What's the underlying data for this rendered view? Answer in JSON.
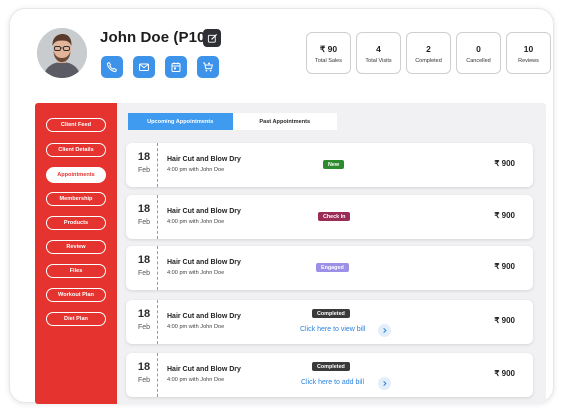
{
  "profile": {
    "name": "John Doe (P101)"
  },
  "actions": [
    {
      "icon": "phone-icon"
    },
    {
      "icon": "mail-icon"
    },
    {
      "icon": "calendar-icon"
    },
    {
      "icon": "cart-icon"
    }
  ],
  "stats": [
    {
      "value": "₹ 90",
      "label": "Total Sales"
    },
    {
      "value": "4",
      "label": "Total Visits"
    },
    {
      "value": "2",
      "label": "Completed"
    },
    {
      "value": "0",
      "label": "Cancelled"
    },
    {
      "value": "10",
      "label": "Reviews"
    }
  ],
  "sidebar": {
    "items": [
      {
        "label": "Client Feed"
      },
      {
        "label": "Client Details"
      },
      {
        "label": "Appointments",
        "active": true
      },
      {
        "label": "Membership"
      },
      {
        "label": "Products"
      },
      {
        "label": "Review"
      },
      {
        "label": "Files"
      },
      {
        "label": "Workout Plan"
      },
      {
        "label": "Diet Plan"
      }
    ]
  },
  "tabs": [
    {
      "label": "Upcoming Appointments",
      "active": true
    },
    {
      "label": "Past Appointments",
      "active": false
    }
  ],
  "appointments": [
    {
      "day": "18",
      "month": "Feb",
      "service": "Hair Cut and Blow Dry",
      "time": "4:00 pm with John Doe",
      "status": "New",
      "status_color": "#2e8b2e",
      "price": "₹ 900"
    },
    {
      "day": "18",
      "month": "Feb",
      "service": "Hair Cut and Blow Dry",
      "time": "4:00 pm with John Doe",
      "status": "Check In",
      "status_color": "#9a2d55",
      "price": "₹ 900"
    },
    {
      "day": "18",
      "month": "Feb",
      "service": "Hair Cut and Blow Dry",
      "time": "4:00 pm with John Doe",
      "status": "Engaged",
      "status_color": "#9b8fe8",
      "price": "₹ 900"
    },
    {
      "day": "18",
      "month": "Feb",
      "service": "Hair Cut and Blow Dry",
      "time": "4:00 pm with John Doe",
      "status": "Completed",
      "status_color": "#3a3a3a",
      "price": "₹ 900",
      "link": "Click here to view bill"
    },
    {
      "day": "18",
      "month": "Feb",
      "service": "Hair Cut and Blow Dry",
      "time": "4:00 pm with John Doe",
      "status": "Completed",
      "status_color": "#3a3a3a",
      "price": "₹ 900",
      "link": "Click here to add bill"
    }
  ],
  "colors": {
    "sidebar": "#e53430",
    "accent_blue": "#3f9bf0",
    "action_blue": "#3d93ea"
  }
}
